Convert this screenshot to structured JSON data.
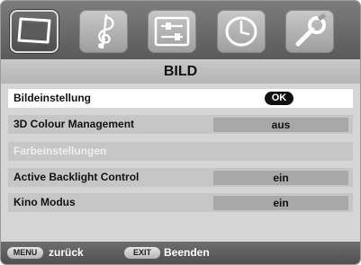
{
  "tabs": [
    {
      "icon": "picture-icon",
      "active": true
    },
    {
      "icon": "music-note-icon",
      "active": false
    },
    {
      "icon": "settings-sliders-icon",
      "active": false
    },
    {
      "icon": "clock-icon",
      "active": false
    },
    {
      "icon": "wrench-icon",
      "active": false
    }
  ],
  "menu": {
    "title": "BILD",
    "items": [
      {
        "label": "Bildeinstellung",
        "value": "OK"
      },
      {
        "label": "3D Colour Management",
        "value": "aus"
      },
      {
        "label": "Farbeinstellungen",
        "value": ""
      },
      {
        "label": "Active Backlight Control",
        "value": "ein"
      },
      {
        "label": "Kino Modus",
        "value": "ein"
      }
    ]
  },
  "footer": {
    "menu_key": "MENU",
    "menu_label": "zurück",
    "exit_key": "EXIT",
    "exit_label": "Beenden"
  }
}
